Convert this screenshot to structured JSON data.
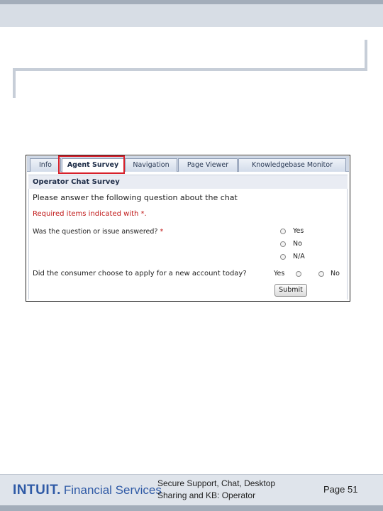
{
  "tabs": [
    {
      "label": "Info"
    },
    {
      "label": "Agent Survey"
    },
    {
      "label": "Navigation"
    },
    {
      "label": "Page Viewer"
    },
    {
      "label": "Knowledgebase Monitor"
    }
  ],
  "survey": {
    "header": "Operator Chat Survey",
    "instructions": "Please answer the following question about the chat",
    "required_note": "Required items indicated with *.",
    "q1": {
      "text": "Was the question or issue answered?",
      "star": "*",
      "options": [
        "Yes",
        "No",
        "N/A"
      ]
    },
    "q2": {
      "text": "Did the consumer choose to apply for a new account today?",
      "options": [
        "Yes",
        "No"
      ]
    },
    "submit_label": "Submit"
  },
  "footer": {
    "logo_brand": "INTUIT.",
    "logo_tag": "Financial Services",
    "doc_title": "Secure Support, Chat, Desktop Sharing and KB: Operator",
    "page": "Page 51"
  },
  "colors": {
    "highlight": "#d8202a",
    "required": "#c01818",
    "brand": "#2f5aa6"
  }
}
